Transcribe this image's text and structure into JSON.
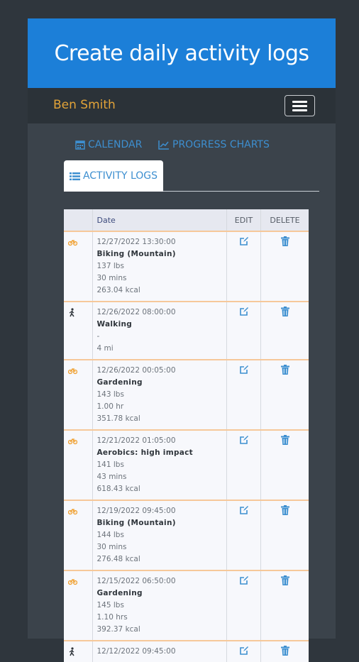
{
  "banner": {
    "title": "Create daily activity logs"
  },
  "navbar": {
    "user_name": "Ben Smith"
  },
  "tabs": [
    {
      "label": "CALENDAR",
      "icon": "calendar-icon"
    },
    {
      "label": "PROGRESS CHARTS",
      "icon": "line-chart-icon"
    },
    {
      "label": "ACTIVITY LOGS",
      "icon": "list-icon",
      "active": true
    }
  ],
  "table": {
    "headers": {
      "date": "Date",
      "edit": "EDIT",
      "delete": "DELETE"
    },
    "rows": [
      {
        "icon": "biking-icon",
        "datetime": "12/27/2022 13:30:00",
        "activity": "Biking (Mountain)",
        "weight": "137 lbs",
        "duration": "30 mins",
        "calories": "263.04 kcal"
      },
      {
        "icon": "walking-icon",
        "datetime": "12/26/2022 08:00:00",
        "activity": "Walking",
        "weight": "-",
        "duration": "4 mi",
        "calories": ""
      },
      {
        "icon": "biking-icon",
        "datetime": "12/26/2022 00:05:00",
        "activity": "Gardening",
        "weight": "143 lbs",
        "duration": "1.00 hr",
        "calories": "351.78 kcal"
      },
      {
        "icon": "biking-icon",
        "datetime": "12/21/2022 01:05:00",
        "activity": "Aerobics: high impact",
        "weight": "141 lbs",
        "duration": "43 mins",
        "calories": "618.43 kcal"
      },
      {
        "icon": "biking-icon",
        "datetime": "12/19/2022 09:45:00",
        "activity": "Biking (Mountain)",
        "weight": "144 lbs",
        "duration": "30 mins",
        "calories": "276.48 kcal"
      },
      {
        "icon": "biking-icon",
        "datetime": "12/15/2022 06:50:00",
        "activity": "Gardening",
        "weight": "145 lbs",
        "duration": "1.10 hrs",
        "calories": "392.37 kcal"
      },
      {
        "icon": "walking-icon",
        "datetime": "12/12/2022 09:45:00",
        "activity": "",
        "weight": "",
        "duration": "",
        "calories": ""
      }
    ]
  },
  "colors": {
    "banner": "#1c7fd8",
    "accent": "#3d8fd0",
    "user_name": "#e2a338",
    "row_separator": "#f6c89a",
    "activity_icon": "#f0a030"
  }
}
